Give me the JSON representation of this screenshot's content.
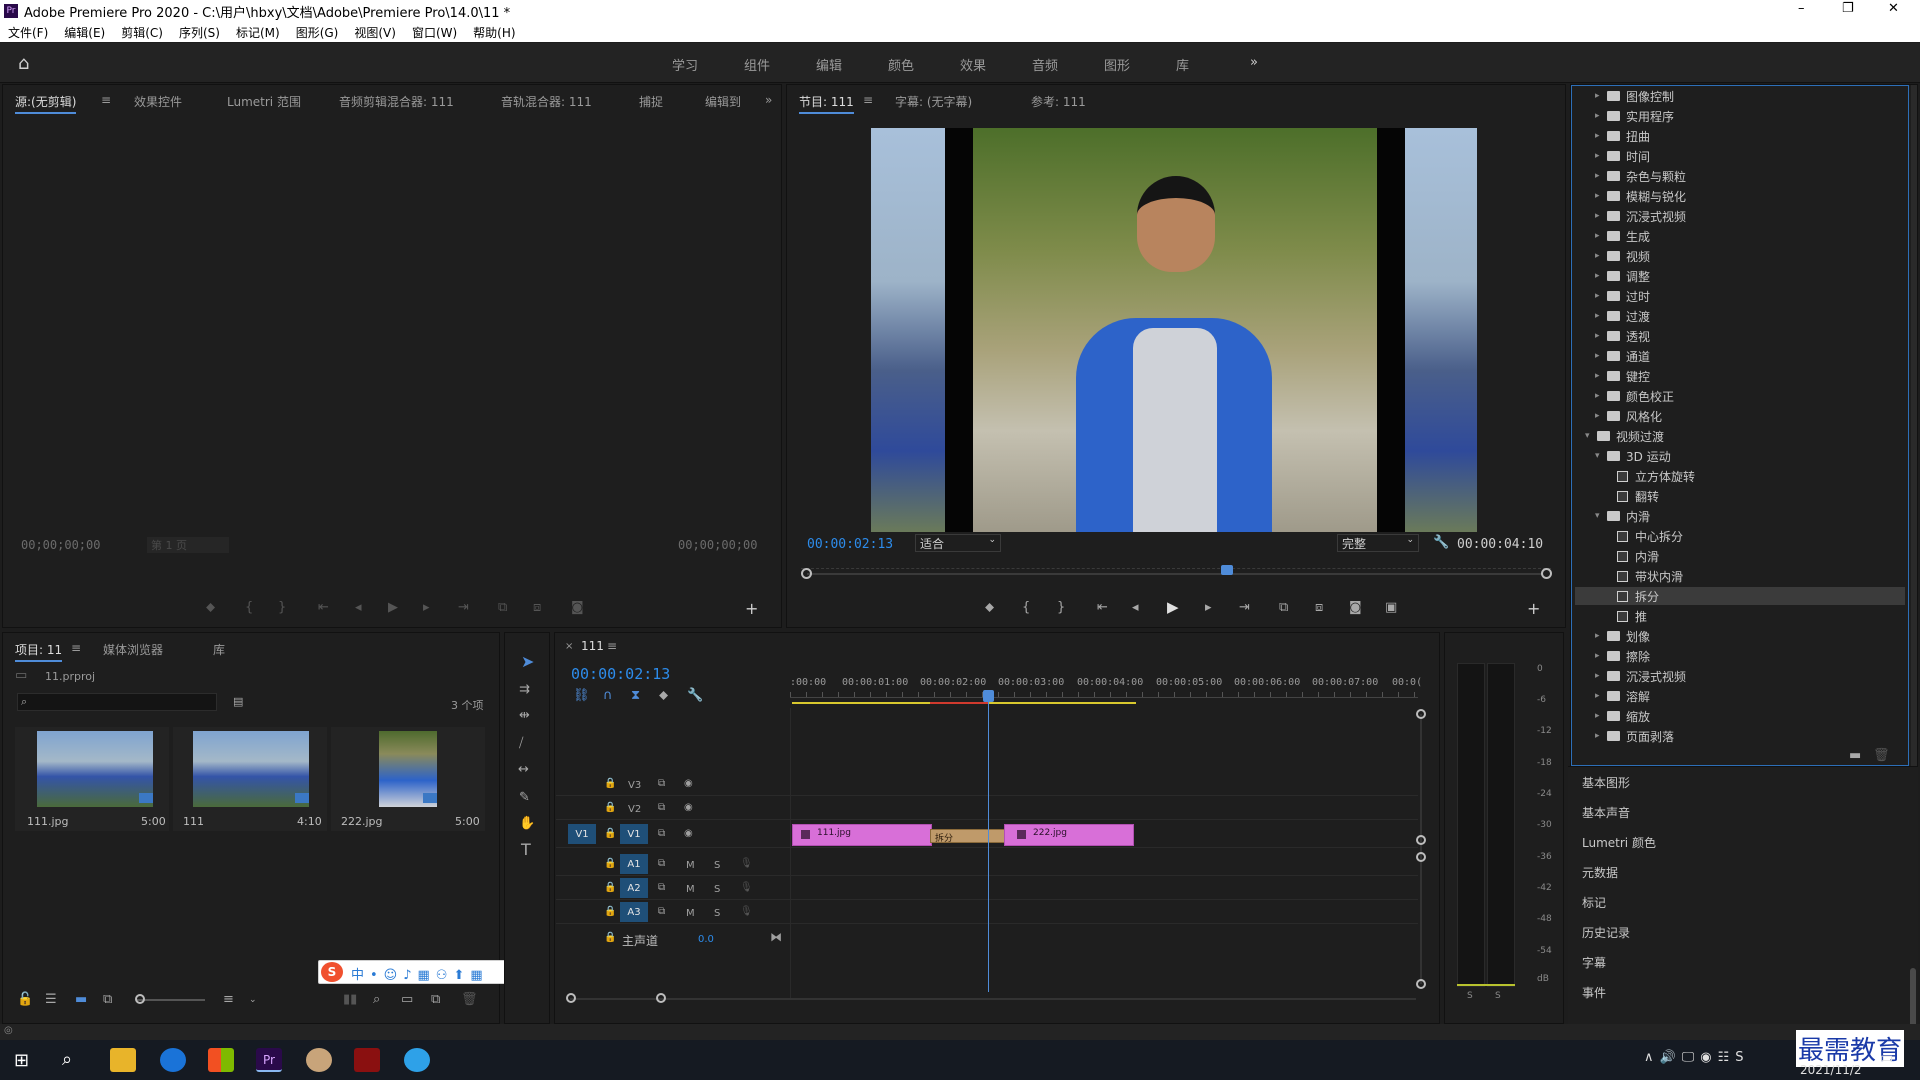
{
  "window": {
    "title": "Adobe Premiere Pro 2020 - C:\\用户\\hbxy\\文档\\Adobe\\Premiere Pro\\14.0\\11 *",
    "controls": [
      "–",
      "❐",
      "✕"
    ]
  },
  "menu": [
    "文件(F)",
    "编辑(E)",
    "剪辑(C)",
    "序列(S)",
    "标记(M)",
    "图形(G)",
    "视图(V)",
    "窗口(W)",
    "帮助(H)"
  ],
  "workspaces": [
    "学习",
    "组件",
    "编辑",
    "颜色",
    "效果",
    "音频",
    "图形",
    "库"
  ],
  "source_panel": {
    "tabs": [
      "源:(无剪辑)",
      "效果控件",
      "Lumetri 范围",
      "音频剪辑混合器: 111",
      "音轨混合器: 111",
      "捕捉",
      "编辑到"
    ],
    "tc_left": "00;00;00;00",
    "tc_right": "00;00;00;00",
    "page": "第 1 页"
  },
  "program_panel": {
    "tabs": [
      "节目: 111",
      "字幕: (无字幕)",
      "参考: 111"
    ],
    "timecode": "00:00:02:13",
    "fit": "适合",
    "quality": "完整",
    "duration": "00:00:04:10"
  },
  "project_panel": {
    "tabs": [
      "项目: 11",
      "媒体浏览器",
      "库"
    ],
    "file": "11.prproj",
    "count": "3 个项",
    "items": [
      {
        "name": "111.jpg",
        "dur": "5:00"
      },
      {
        "name": "111",
        "dur": "4:10"
      },
      {
        "name": "222.jpg",
        "dur": "5:00"
      }
    ]
  },
  "timeline": {
    "tab": "111",
    "timecode": "00:00:02:13",
    "ruler": [
      ":00:00",
      "00:00:01:00",
      "00:00:02:00",
      "00:00:03:00",
      "00:00:04:00",
      "00:00:05:00",
      "00:00:06:00",
      "00:00:07:00",
      "00:0("
    ],
    "tracks": {
      "v3": "V3",
      "v2": "V2",
      "v1": "V1",
      "v1_src": "V1",
      "a1": "A1",
      "a2": "A2",
      "a3": "A3",
      "m": "M",
      "s": "S",
      "master": "主声道",
      "master_val": "0.0"
    },
    "clips": {
      "clip1": "111.jpg",
      "transition": "拆分",
      "clip2": "222.jpg"
    }
  },
  "meter": {
    "labels": [
      "0",
      "-6",
      "-12",
      "-18",
      "-24",
      "-30",
      "-36",
      "-42",
      "-48",
      "-54",
      "dB"
    ],
    "s": "S"
  },
  "effects_tree": [
    {
      "indent": 1,
      "type": "folder",
      "open": false,
      "label": "图像控制"
    },
    {
      "indent": 1,
      "type": "folder",
      "open": false,
      "label": "实用程序"
    },
    {
      "indent": 1,
      "type": "folder",
      "open": false,
      "label": "扭曲"
    },
    {
      "indent": 1,
      "type": "folder",
      "open": false,
      "label": "时间"
    },
    {
      "indent": 1,
      "type": "folder",
      "open": false,
      "label": "杂色与颗粒"
    },
    {
      "indent": 1,
      "type": "folder",
      "open": false,
      "label": "模糊与锐化"
    },
    {
      "indent": 1,
      "type": "folder",
      "open": false,
      "label": "沉浸式视频"
    },
    {
      "indent": 1,
      "type": "folder",
      "open": false,
      "label": "生成"
    },
    {
      "indent": 1,
      "type": "folder",
      "open": false,
      "label": "视频"
    },
    {
      "indent": 1,
      "type": "folder",
      "open": false,
      "label": "调整"
    },
    {
      "indent": 1,
      "type": "folder",
      "open": false,
      "label": "过时"
    },
    {
      "indent": 1,
      "type": "folder",
      "open": false,
      "label": "过渡"
    },
    {
      "indent": 1,
      "type": "folder",
      "open": false,
      "label": "透视"
    },
    {
      "indent": 1,
      "type": "folder",
      "open": false,
      "label": "通道"
    },
    {
      "indent": 1,
      "type": "folder",
      "open": false,
      "label": "键控"
    },
    {
      "indent": 1,
      "type": "folder",
      "open": false,
      "label": "颜色校正"
    },
    {
      "indent": 1,
      "type": "folder",
      "open": false,
      "label": "风格化"
    },
    {
      "indent": 0,
      "type": "folder",
      "open": true,
      "label": "视频过渡"
    },
    {
      "indent": 1,
      "type": "folder",
      "open": true,
      "label": "3D 运动"
    },
    {
      "indent": 2,
      "type": "fx",
      "label": "立方体旋转"
    },
    {
      "indent": 2,
      "type": "fx",
      "label": "翻转"
    },
    {
      "indent": 1,
      "type": "folder",
      "open": true,
      "label": "内滑"
    },
    {
      "indent": 2,
      "type": "fx",
      "label": "中心拆分"
    },
    {
      "indent": 2,
      "type": "fx",
      "label": "内滑"
    },
    {
      "indent": 2,
      "type": "fx",
      "label": "带状内滑"
    },
    {
      "indent": 2,
      "type": "fx",
      "label": "拆分",
      "selected": true
    },
    {
      "indent": 2,
      "type": "fx",
      "label": "推"
    },
    {
      "indent": 1,
      "type": "folder",
      "open": false,
      "label": "划像"
    },
    {
      "indent": 1,
      "type": "folder",
      "open": false,
      "label": "擦除"
    },
    {
      "indent": 1,
      "type": "folder",
      "open": false,
      "label": "沉浸式视频"
    },
    {
      "indent": 1,
      "type": "folder",
      "open": false,
      "label": "溶解"
    },
    {
      "indent": 1,
      "type": "folder",
      "open": false,
      "label": "缩放"
    },
    {
      "indent": 1,
      "type": "folder",
      "open": false,
      "label": "页面剥落"
    }
  ],
  "side_panels": [
    "基本图形",
    "基本声音",
    "Lumetri 颜色",
    "元数据",
    "标记",
    "历史记录",
    "字幕",
    "事件"
  ],
  "taskbar": {
    "date": "2021/11/2",
    "watermark": "最需教育"
  },
  "colors": {
    "accent_blue": "#2d8ceb",
    "clip_pink": "#d86fd8",
    "transition": "#bf9a6a",
    "playhead": "#4f8cd9"
  }
}
